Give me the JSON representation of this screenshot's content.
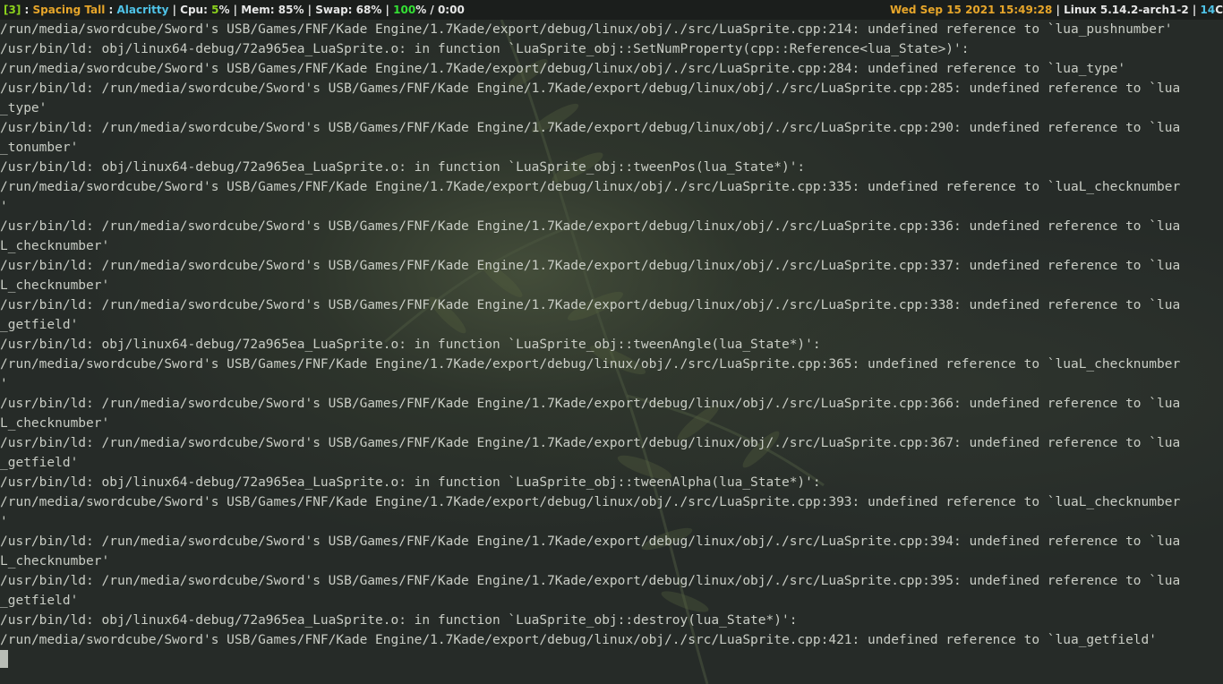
{
  "status_bar": {
    "workspace": "[3]",
    "sep1": " : ",
    "layout": "Spacing Tall",
    "sep2": " : ",
    "window": "Alacritty",
    "sep3": " | Cpu: ",
    "cpu_value": "5",
    "cpu_unit": "% | Mem: ",
    "mem": "85%",
    "swap_label": " | Swap: ",
    "swap": "68%",
    "sep4": " | ",
    "battery_value": "100",
    "battery_rest": "% / 0:00",
    "datetime": "Wed Sep 15 2021 15:49:28",
    "sep5": " | ",
    "kernel": "Linux 5.14.2-arch1-2",
    "sep6": " | ",
    "temp_value": "14",
    "temp_unit": "C"
  },
  "terminal": {
    "lines": [
      "/run/media/swordcube/Sword's USB/Games/FNF/Kade Engine/1.7Kade/export/debug/linux/obj/./src/LuaSprite.cpp:214: undefined reference to `lua_pushnumber'",
      "/usr/bin/ld: obj/linux64-debug/72a965ea_LuaSprite.o: in function `LuaSprite_obj::SetNumProperty(cpp::Reference<lua_State>)':",
      "/run/media/swordcube/Sword's USB/Games/FNF/Kade Engine/1.7Kade/export/debug/linux/obj/./src/LuaSprite.cpp:284: undefined reference to `lua_type'",
      "/usr/bin/ld: /run/media/swordcube/Sword's USB/Games/FNF/Kade Engine/1.7Kade/export/debug/linux/obj/./src/LuaSprite.cpp:285: undefined reference to `lua",
      "_type'",
      "/usr/bin/ld: /run/media/swordcube/Sword's USB/Games/FNF/Kade Engine/1.7Kade/export/debug/linux/obj/./src/LuaSprite.cpp:290: undefined reference to `lua",
      "_tonumber'",
      "/usr/bin/ld: obj/linux64-debug/72a965ea_LuaSprite.o: in function `LuaSprite_obj::tweenPos(lua_State*)':",
      "/run/media/swordcube/Sword's USB/Games/FNF/Kade Engine/1.7Kade/export/debug/linux/obj/./src/LuaSprite.cpp:335: undefined reference to `luaL_checknumber",
      "'",
      "/usr/bin/ld: /run/media/swordcube/Sword's USB/Games/FNF/Kade Engine/1.7Kade/export/debug/linux/obj/./src/LuaSprite.cpp:336: undefined reference to `lua",
      "L_checknumber'",
      "/usr/bin/ld: /run/media/swordcube/Sword's USB/Games/FNF/Kade Engine/1.7Kade/export/debug/linux/obj/./src/LuaSprite.cpp:337: undefined reference to `lua",
      "L_checknumber'",
      "/usr/bin/ld: /run/media/swordcube/Sword's USB/Games/FNF/Kade Engine/1.7Kade/export/debug/linux/obj/./src/LuaSprite.cpp:338: undefined reference to `lua",
      "_getfield'",
      "/usr/bin/ld: obj/linux64-debug/72a965ea_LuaSprite.o: in function `LuaSprite_obj::tweenAngle(lua_State*)':",
      "/run/media/swordcube/Sword's USB/Games/FNF/Kade Engine/1.7Kade/export/debug/linux/obj/./src/LuaSprite.cpp:365: undefined reference to `luaL_checknumber",
      "'",
      "/usr/bin/ld: /run/media/swordcube/Sword's USB/Games/FNF/Kade Engine/1.7Kade/export/debug/linux/obj/./src/LuaSprite.cpp:366: undefined reference to `lua",
      "L_checknumber'",
      "/usr/bin/ld: /run/media/swordcube/Sword's USB/Games/FNF/Kade Engine/1.7Kade/export/debug/linux/obj/./src/LuaSprite.cpp:367: undefined reference to `lua",
      "_getfield'",
      "/usr/bin/ld: obj/linux64-debug/72a965ea_LuaSprite.o: in function `LuaSprite_obj::tweenAlpha(lua_State*)':",
      "/run/media/swordcube/Sword's USB/Games/FNF/Kade Engine/1.7Kade/export/debug/linux/obj/./src/LuaSprite.cpp:393: undefined reference to `luaL_checknumber",
      "'",
      "/usr/bin/ld: /run/media/swordcube/Sword's USB/Games/FNF/Kade Engine/1.7Kade/export/debug/linux/obj/./src/LuaSprite.cpp:394: undefined reference to `lua",
      "L_checknumber'",
      "/usr/bin/ld: /run/media/swordcube/Sword's USB/Games/FNF/Kade Engine/1.7Kade/export/debug/linux/obj/./src/LuaSprite.cpp:395: undefined reference to `lua",
      "_getfield'",
      "/usr/bin/ld: obj/linux64-debug/72a965ea_LuaSprite.o: in function `LuaSprite_obj::destroy(lua_State*)':",
      "/run/media/swordcube/Sword's USB/Games/FNF/Kade Engine/1.7Kade/export/debug/linux/obj/./src/LuaSprite.cpp:421: undefined reference to `lua_getfield'"
    ]
  },
  "colors": {
    "bar_background": "#1b1e1c",
    "workspace": "#8bd11c",
    "layout": "#e6a52a",
    "window_title": "#4fc3e8",
    "cpu": "#8bd11c",
    "battery": "#34e034",
    "datetime": "#e6a52a",
    "temp": "#4fc3e8",
    "terminal_text": "#c9cdc5",
    "terminal_background": "#262b28"
  }
}
